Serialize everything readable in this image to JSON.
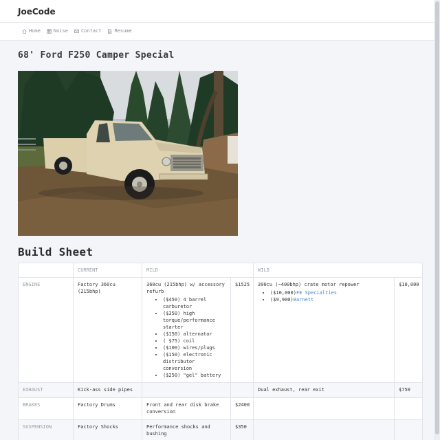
{
  "site": {
    "brand": "JoeCode"
  },
  "nav": [
    {
      "label": "Home",
      "icon": "home-icon"
    },
    {
      "label": "Noise",
      "icon": "grid-icon"
    },
    {
      "label": "Contact",
      "icon": "envelope-icon"
    },
    {
      "label": "Resume",
      "icon": "document-icon"
    }
  ],
  "page": {
    "title": "68' Ford F250 Camper Special"
  },
  "photo": {
    "description_colors": {
      "truck": "#dcd0ac",
      "ground": "#6b5538",
      "trees": "#27442a"
    }
  },
  "build": {
    "title": "Build Sheet",
    "headers": {
      "blank": "",
      "current": "CURRENT",
      "mild": "MILD",
      "wild": "WILD"
    },
    "rows": {
      "engine": {
        "label": "ENGINE",
        "current": "Factory 360cu (215bhp)",
        "mild": "360cu (215bhp) w/ accessory refurb",
        "mild_items": [
          "($450) 4 barrel carburetor",
          "($350) high torque/performance starter",
          "($150) alternator",
          "( $75) coil",
          "($100) wires/plugs",
          "($150) electronic distributor conversion",
          "($250) \"gel\" battery"
        ],
        "mild_cost": "$1525",
        "wild": "390cu (~400bhp) crate motor repower",
        "wild_items": [
          {
            "prefix": "($10,000)",
            "link": "FE Specialties"
          },
          {
            "prefix": "($9,900)",
            "link": "Barnett"
          }
        ],
        "wild_cost": "$10,000"
      },
      "exhaust": {
        "label": "EXHAUST",
        "current": "Kick-ass side pipes",
        "mild": "",
        "mild_cost": "",
        "wild": "Dual exhaust, rear exit",
        "wild_cost": "$750"
      },
      "brakes": {
        "label": "BRAKES",
        "current": "Factory Drums",
        "mild": "Front and rear disk brake conversion",
        "mild_cost": "$2400",
        "wild": "",
        "wild_cost": ""
      },
      "suspension": {
        "label": "SUSPENSION",
        "current": "Factory Shocks",
        "mild": "Performance shocks and bushing",
        "mild_cost": "$350",
        "wild": "",
        "wild_cost": ""
      }
    }
  },
  "colors": {
    "link": "#4a86c5",
    "muted": "#9a9da8",
    "background": "#f4f5f9"
  }
}
